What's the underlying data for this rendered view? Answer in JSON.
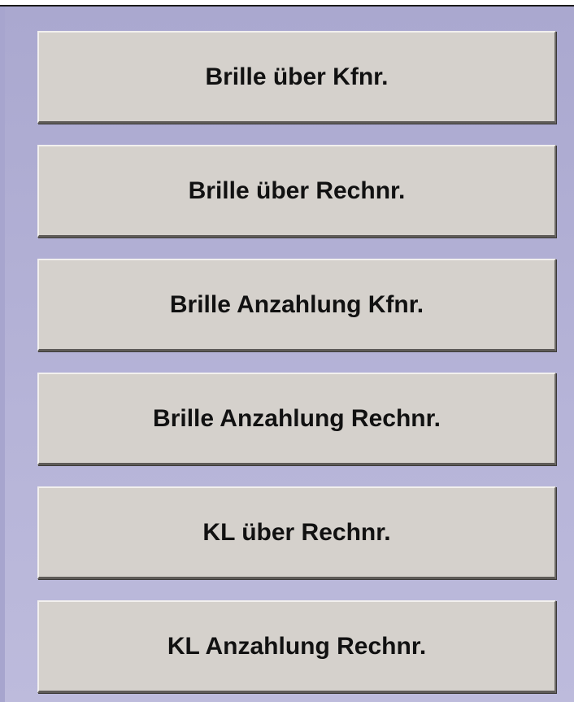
{
  "buttons": [
    {
      "label": "Brille über Kfnr."
    },
    {
      "label": "Brille über Rechnr."
    },
    {
      "label": "Brille Anzahlung Kfnr."
    },
    {
      "label": "Brille Anzahlung Rechnr."
    },
    {
      "label": "KL über Rechnr."
    },
    {
      "label": "KL Anzahlung Rechnr."
    }
  ],
  "colors": {
    "panel_background": "#b0aed3",
    "button_face": "#d5d1cc",
    "button_text": "#111111"
  }
}
